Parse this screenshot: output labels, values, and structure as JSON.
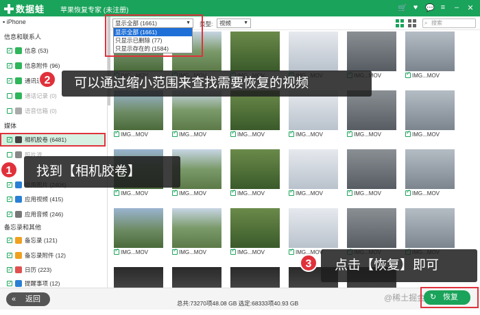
{
  "titlebar": {
    "app_name": "数据蛙",
    "title": "苹果恢复专家 (未注册)"
  },
  "sidebar": {
    "device": "iPhone",
    "sections": [
      {
        "label": "信息和联系人"
      },
      {
        "label": "媒体"
      },
      {
        "label": "备忘录和其他"
      }
    ],
    "items": [
      {
        "label": "信息 (53)",
        "color": "#2fb55a"
      },
      {
        "label": "信息附件 (96)",
        "color": "#2fb55a"
      },
      {
        "label": "通讯录",
        "color": "#2fb55a"
      },
      {
        "label": "通话记录 (0)",
        "color": "#2fb55a"
      },
      {
        "label": "语音信箱 (0)",
        "color": "#aaaaaa"
      },
      {
        "label": "相机胶卷 (6481)",
        "color": "#444444"
      },
      {
        "label": "照片流",
        "color": "#888888"
      },
      {
        "label": "应用图片 (2406)",
        "color": "#2a7fd4"
      },
      {
        "label": "应用视频 (415)",
        "color": "#2a7fd4"
      },
      {
        "label": "应用音频 (246)",
        "color": "#777777"
      },
      {
        "label": "备忘录 (121)",
        "color": "#f0a020"
      },
      {
        "label": "备忘录附件 (12)",
        "color": "#f0a020"
      },
      {
        "label": "日历 (223)",
        "color": "#e05050"
      },
      {
        "label": "提醒事项 (12)",
        "color": "#2a7fd4"
      }
    ]
  },
  "toolbar": {
    "filter_selected": "显示全部 (1661)",
    "type_label": "类型:",
    "type_selected": "视频",
    "search_placeholder": "搜索"
  },
  "dropdown": {
    "options": [
      "显示全部 (1661)",
      "只显示已删除 (77)",
      "只显示存在的 (1584)"
    ]
  },
  "grid": {
    "caption": "IMG...MOV"
  },
  "callouts": {
    "c1": {
      "num": "1",
      "text": "找到【相机胶卷】"
    },
    "c2": {
      "num": "2",
      "text": "可以通过缩小范围来查找需要恢复的视频"
    },
    "c3": {
      "num": "3",
      "text": "点击【恢复】即可"
    }
  },
  "bottom": {
    "back_label": "返回",
    "totals": "总共:73270项48.08 GB 选定:68333项40.93 GB",
    "recover_label": "恢复",
    "watermark": "@稀土掘金技术社区"
  }
}
